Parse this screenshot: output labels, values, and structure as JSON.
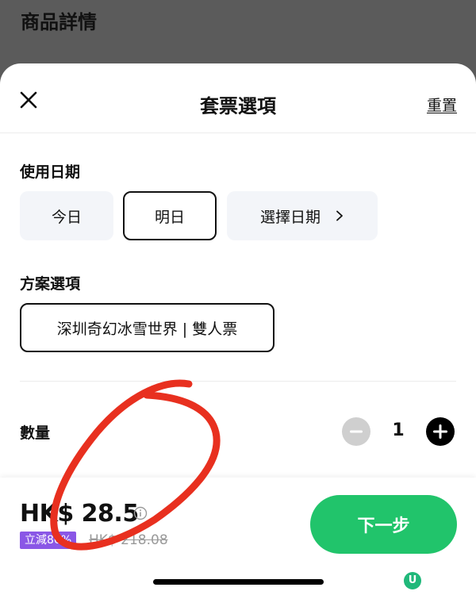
{
  "background": {
    "title": "商品詳情"
  },
  "sheet": {
    "title": "套票選項",
    "reset_label": "重置"
  },
  "date_section": {
    "label": "使用日期",
    "options": [
      "今日",
      "明日",
      "選擇日期"
    ],
    "selected": "明日"
  },
  "plan_section": {
    "label": "方案選項",
    "options": [
      "深圳奇幻冰雪世界 | 雙人票"
    ],
    "selected": "深圳奇幻冰雪世界 | 雙人票"
  },
  "quantity": {
    "label": "數量",
    "value": "1"
  },
  "footer": {
    "price": "HK$ 28.5",
    "discount_badge": "立減80%",
    "original_price": "HK$ 218.08",
    "next_label": "下一步"
  },
  "colors": {
    "accent_green": "#21c46b",
    "discount_purple": "#8a57e6",
    "scribble_red": "#e8301f"
  },
  "watermark": "U"
}
